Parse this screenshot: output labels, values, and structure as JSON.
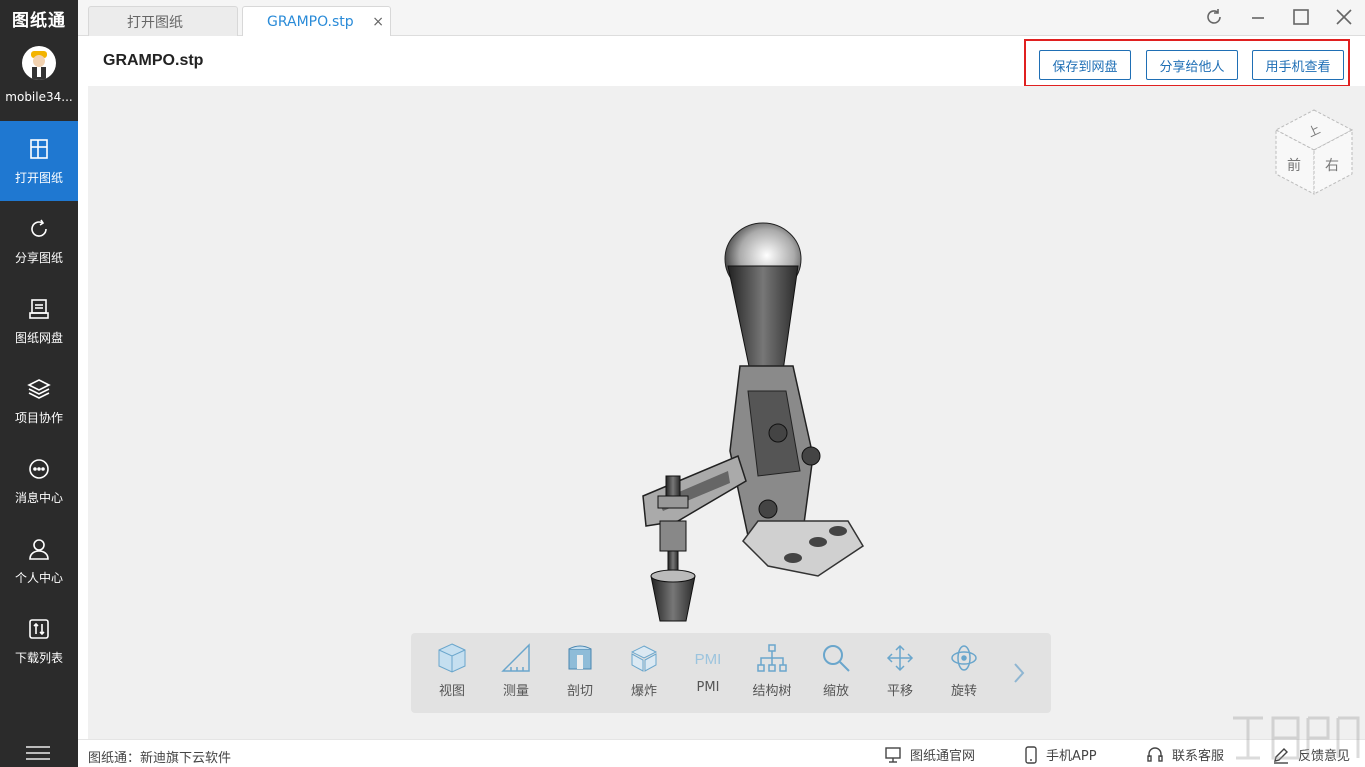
{
  "app": {
    "logo": "图纸通",
    "username": "mobile34..."
  },
  "sidebar": {
    "items": [
      {
        "label": "打开图纸",
        "icon": "open-drawing-icon",
        "active": true
      },
      {
        "label": "分享图纸",
        "icon": "share-drawing-icon",
        "active": false
      },
      {
        "label": "图纸网盘",
        "icon": "cloud-disk-icon",
        "active": false
      },
      {
        "label": "项目协作",
        "icon": "layers-icon",
        "active": false
      },
      {
        "label": "消息中心",
        "icon": "message-icon",
        "active": false
      },
      {
        "label": "个人中心",
        "icon": "user-icon",
        "active": false
      },
      {
        "label": "下载列表",
        "icon": "download-list-icon",
        "active": false
      }
    ]
  },
  "tabs": [
    {
      "label": "打开图纸",
      "active": false
    },
    {
      "label": "GRAMPO.stp",
      "active": true,
      "close": "×"
    }
  ],
  "document": {
    "title": "GRAMPO.stp"
  },
  "actions": {
    "save": "保存到网盘",
    "share": "分享给他人",
    "mobile": "用手机查看"
  },
  "viewcube": {
    "top": "上",
    "front": "前",
    "right": "右"
  },
  "toolbar": {
    "items": [
      {
        "label": "视图",
        "icon": "view-cube-icon"
      },
      {
        "label": "测量",
        "icon": "ruler-icon"
      },
      {
        "label": "剖切",
        "icon": "section-cut-icon"
      },
      {
        "label": "爆炸",
        "icon": "explode-icon"
      },
      {
        "label": "PMI",
        "icon": "pmi-icon"
      },
      {
        "label": "结构树",
        "icon": "structure-tree-icon"
      },
      {
        "label": "缩放",
        "icon": "zoom-icon"
      },
      {
        "label": "平移",
        "icon": "pan-icon"
      },
      {
        "label": "旋转",
        "icon": "rotate-icon"
      }
    ]
  },
  "status": {
    "text": "图纸通：新迪旗下云软件",
    "website": "图纸通官网",
    "app": "手机APP",
    "support": "联系客服",
    "feedback": "反馈意见"
  },
  "colors": {
    "accent": "#1f78d1",
    "sidebar_bg": "#2b2b2b",
    "highlight_border": "#e02020"
  }
}
